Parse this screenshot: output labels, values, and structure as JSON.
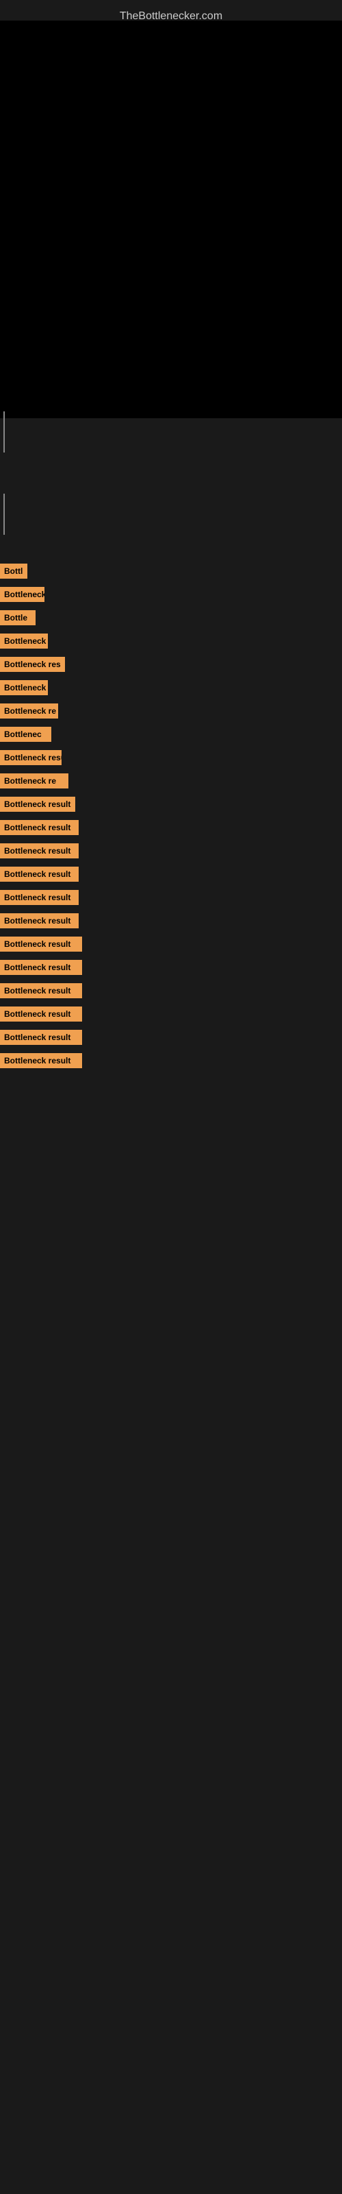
{
  "site": {
    "title": "TheBottlenecker.com"
  },
  "results": [
    {
      "id": 1,
      "label": "Bottl",
      "class": "item-1"
    },
    {
      "id": 2,
      "label": "Bottleneck",
      "class": "item-2"
    },
    {
      "id": 3,
      "label": "Bottle",
      "class": "item-3"
    },
    {
      "id": 4,
      "label": "Bottleneck",
      "class": "item-4"
    },
    {
      "id": 5,
      "label": "Bottleneck res",
      "class": "item-5"
    },
    {
      "id": 6,
      "label": "Bottleneck",
      "class": "item-6"
    },
    {
      "id": 7,
      "label": "Bottleneck re",
      "class": "item-7"
    },
    {
      "id": 8,
      "label": "Bottlenec",
      "class": "item-8"
    },
    {
      "id": 9,
      "label": "Bottleneck resu",
      "class": "item-9"
    },
    {
      "id": 10,
      "label": "Bottleneck re",
      "class": "item-10"
    },
    {
      "id": 11,
      "label": "Bottleneck result",
      "class": "item-11"
    },
    {
      "id": 12,
      "label": "Bottleneck result",
      "class": "item-12"
    },
    {
      "id": 13,
      "label": "Bottleneck result",
      "class": "item-13"
    },
    {
      "id": 14,
      "label": "Bottleneck result",
      "class": "item-14"
    },
    {
      "id": 15,
      "label": "Bottleneck result",
      "class": "item-15"
    },
    {
      "id": 16,
      "label": "Bottleneck result",
      "class": "item-16"
    },
    {
      "id": 17,
      "label": "Bottleneck result",
      "class": "item-17"
    },
    {
      "id": 18,
      "label": "Bottleneck result",
      "class": "item-18"
    },
    {
      "id": 19,
      "label": "Bottleneck result",
      "class": "item-19"
    },
    {
      "id": 20,
      "label": "Bottleneck result",
      "class": "item-20"
    },
    {
      "id": 21,
      "label": "Bottleneck result",
      "class": "item-21"
    },
    {
      "id": 22,
      "label": "Bottleneck result",
      "class": "item-22"
    }
  ]
}
